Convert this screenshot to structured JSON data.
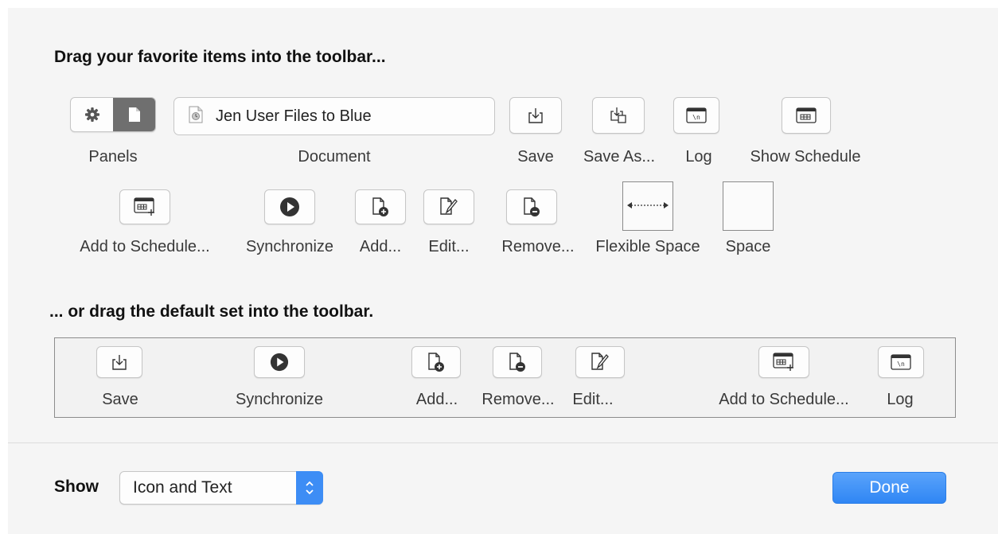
{
  "sheet": {
    "heading_favorites": "Drag your favorite items into the toolbar...",
    "heading_default": "... or drag the default set into the toolbar.",
    "favorites": {
      "panels": {
        "label": "Panels",
        "icons": [
          "gear-icon",
          "document-icon"
        ],
        "selected": "document-icon"
      },
      "document": {
        "label": "Document",
        "value": "Jen User Files to Blue",
        "icon": "document-file-icon"
      },
      "save": {
        "label": "Save",
        "icon": "save-icon"
      },
      "save_as": {
        "label": "Save As...",
        "icon": "save-as-icon"
      },
      "log": {
        "label": "Log",
        "icon": "log-icon"
      },
      "show_schedule": {
        "label": "Show Schedule",
        "icon": "schedule-icon"
      },
      "add_to_schedule": {
        "label": "Add to Schedule...",
        "icon": "add-schedule-icon"
      },
      "synchronize": {
        "label": "Synchronize",
        "icon": "play-icon"
      },
      "add": {
        "label": "Add...",
        "icon": "add-document-icon"
      },
      "edit": {
        "label": "Edit...",
        "icon": "edit-document-icon"
      },
      "remove": {
        "label": "Remove...",
        "icon": "remove-document-icon"
      },
      "flexible_space": {
        "label": "Flexible Space",
        "icon": "flexible-space-icon"
      },
      "space": {
        "label": "Space"
      }
    },
    "default_set": {
      "save": "Save",
      "synchronize": "Synchronize",
      "add": "Add...",
      "remove": "Remove...",
      "edit": "Edit...",
      "add_to_schedule": "Add to Schedule...",
      "log": "Log"
    }
  },
  "footer": {
    "show_label": "Show",
    "show_value": "Icon and Text",
    "done_label": "Done"
  },
  "colors": {
    "accent": "#3d8df5",
    "sheet_background": "#f5f5f5",
    "segment_selected": "#6f6f6f"
  }
}
